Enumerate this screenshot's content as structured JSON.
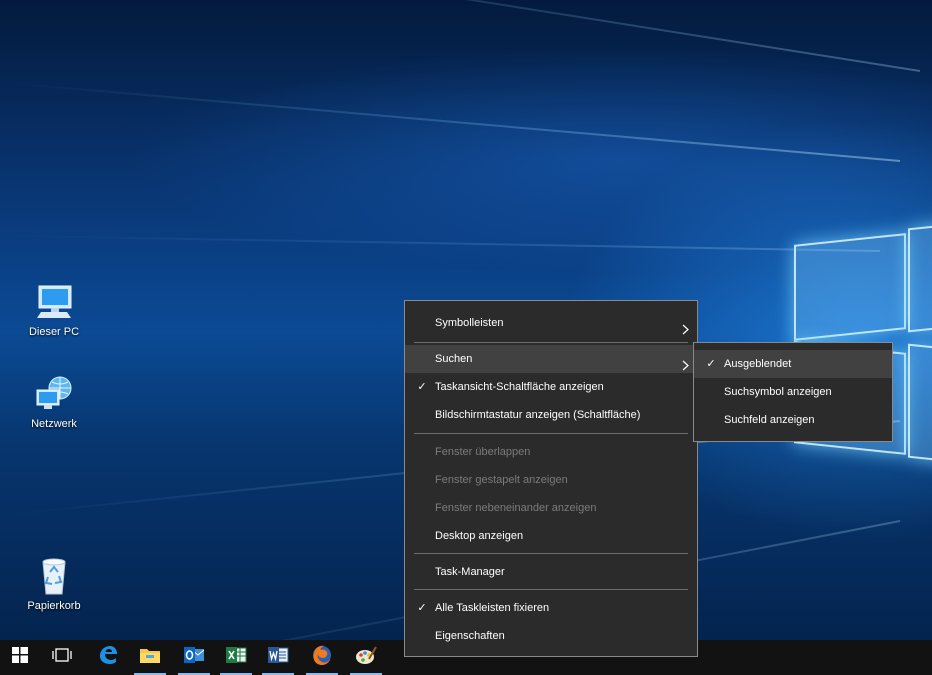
{
  "desktop_icons": [
    {
      "label": "Dieser PC",
      "icon": "computer-icon"
    },
    {
      "label": "Netzwerk",
      "icon": "network-icon"
    },
    {
      "label": "Papierkorb",
      "icon": "recycle-bin-icon"
    }
  ],
  "context_menu": {
    "items": [
      {
        "label": "Symbolleisten"
      },
      {
        "label": "Suchen"
      },
      {
        "label": "Taskansicht-Schaltfläche anzeigen",
        "checked": true
      },
      {
        "label": "Bildschirmtastatur anzeigen (Schaltfläche)"
      },
      {
        "label": "Fenster überlappen",
        "disabled": true
      },
      {
        "label": "Fenster gestapelt anzeigen",
        "disabled": true
      },
      {
        "label": "Fenster nebeneinander anzeigen",
        "disabled": true
      },
      {
        "label": "Desktop anzeigen"
      },
      {
        "label": "Task-Manager"
      },
      {
        "label": "Alle Taskleisten fixieren",
        "checked": true
      },
      {
        "label": "Eigenschaften"
      }
    ]
  },
  "submenu": {
    "items": [
      {
        "label": "Ausgeblendet",
        "checked": true
      },
      {
        "label": "Suchsymbol anzeigen"
      },
      {
        "label": "Suchfeld anzeigen"
      }
    ]
  },
  "icons": {
    "check": "✓",
    "submenu_arrow": "chevron-right-icon"
  },
  "taskbar": {
    "items": [
      "start-icon",
      "task-view-icon",
      "edge-icon",
      "file-explorer-icon",
      "outlook-icon",
      "excel-icon",
      "word-icon",
      "firefox-icon",
      "paint-icon"
    ]
  },
  "colors": {
    "menu_bg": "#2b2b2b",
    "menu_highlight": "#414141",
    "disabled_text": "#7b7b7b",
    "taskbar_bg": "#121212"
  }
}
